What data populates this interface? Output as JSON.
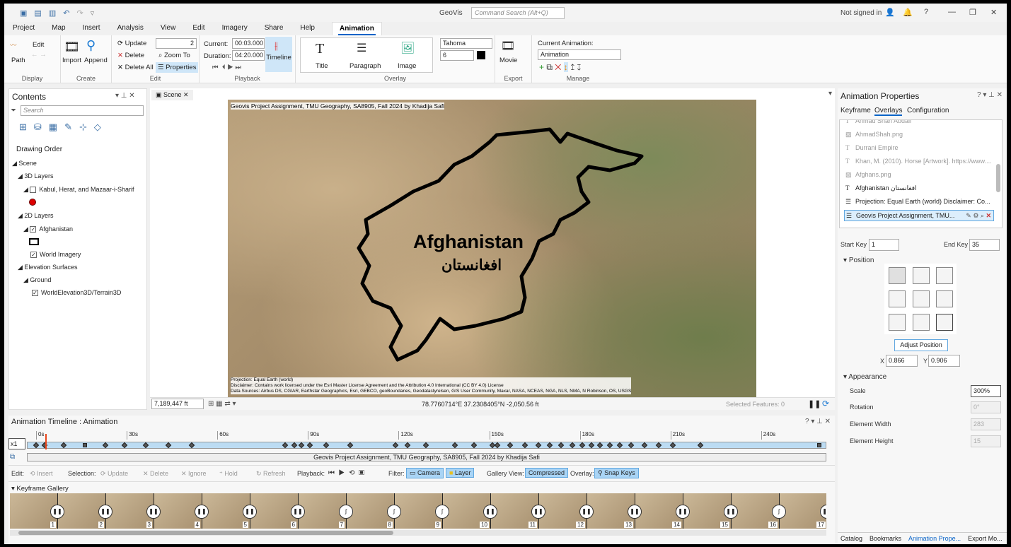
{
  "app": {
    "title": "GeoVis",
    "search_placeholder": "Command Search (Alt+Q)",
    "signin": "Not signed in",
    "help": "?"
  },
  "menu_tabs": [
    "Project",
    "Map",
    "Insert",
    "Analysis",
    "View",
    "Edit",
    "Imagery",
    "Share",
    "Help",
    "Animation"
  ],
  "ribbon": {
    "display": {
      "label": "Display",
      "path": "Path",
      "edit": "Edit"
    },
    "create": {
      "label": "Create",
      "import": "Import",
      "append": "Append"
    },
    "edit": {
      "label": "Edit",
      "update": "Update",
      "delete": "Delete",
      "delete_all": "Delete All",
      "zoom_to": "Zoom To",
      "properties": "Properties",
      "key_value": "2"
    },
    "playback": {
      "label": "Playback",
      "current_label": "Current:",
      "current": "00:03.000",
      "duration_label": "Duration:",
      "duration": "04:20.000",
      "timeline": "Timeline"
    },
    "overlay": {
      "label": "Overlay",
      "title": "Title",
      "paragraph": "Paragraph",
      "image": "Image",
      "font": "Tahoma",
      "size": "6",
      "color": "#000000"
    },
    "export": {
      "label": "Export",
      "movie": "Movie"
    },
    "manage": {
      "label": "Manage",
      "current_animation_label": "Current Animation:",
      "current_animation": "Animation"
    }
  },
  "contents": {
    "title": "Contents",
    "search_placeholder": "Search",
    "drawing_order": "Drawing Order",
    "tree": [
      {
        "label": "Scene",
        "level": 0
      },
      {
        "label": "3D Layers",
        "level": 1
      },
      {
        "label": "Kabul, Herat, and Mazaar-i-Sharif",
        "level": 2,
        "checked": false
      },
      {
        "label": "2D Layers",
        "level": 1
      },
      {
        "label": "Afghanistan",
        "level": 2,
        "checked": true
      },
      {
        "label": "World Imagery",
        "level": 2,
        "checked": true
      },
      {
        "label": "Elevation Surfaces",
        "level": 1
      },
      {
        "label": "Ground",
        "level": 2
      },
      {
        "label": "WorldElevation3D/Terrain3D",
        "level": 3,
        "checked": true
      }
    ]
  },
  "scene": {
    "tab": "Scene",
    "title_overlay": "Geovis Project Assignment, TMU Geography, SA8905, Fall 2024 by Khadija Safi",
    "label_en": "Afghanistan",
    "label_fa": "افغانستان",
    "footer": [
      "Projection: Equal Earth (world)",
      "Disclaimer: Contains work licensed under the Esri Master License Agreement and the Attribution 4.0 International (CC BY 4.0) License",
      "Data Sources: Airbus DS, CGIAR, Earthstar Geographics, Esri, GEBCO, geoBoundaries, Geodatastyrelsen, GIS User Community, Maxar, NASA, NCEAS, NGA, NLS, NMA, N Robinson, OS, USGS"
    ],
    "scale": "7,189,447 ft",
    "coords": "78.7760714°E 37.2308405°N",
    "elevation": "-2,050.56 ft",
    "selected": "Selected Features: 0"
  },
  "timeline": {
    "title": "Animation Timeline : Animation",
    "speed": "x1",
    "ticks": [
      "0s",
      "30s",
      "60s",
      "90s",
      "120s",
      "150s",
      "180s",
      "210s",
      "240s"
    ],
    "current_time": 3,
    "keyframes": [
      0,
      2.8,
      9.1,
      16.2,
      23,
      29.3,
      36.3,
      43.8,
      51.5,
      82.4,
      85.5,
      87.8,
      90.6,
      96,
      104,
      119,
      123,
      129,
      138.7,
      145,
      151,
      152.8,
      157,
      161.8,
      166.2,
      170,
      173.7,
      177.5,
      180.7,
      183.8,
      186.6,
      189.9,
      193.2,
      196.9,
      201.4,
      206,
      210.8,
      219.9,
      259.3
    ],
    "overlay_track": "Geovis Project Assignment, TMU Geography, SA8905, Fall 2024 by Khadija Safi",
    "toolbar": {
      "edit": "Edit:",
      "insert": "Insert",
      "selection": "Selection:",
      "update": "Update",
      "delete": "Delete",
      "ignore": "Ignore",
      "hold": "Hold",
      "refresh": "Refresh",
      "playback": "Playback:",
      "filter": "Filter:",
      "camera": "Camera",
      "layer": "Layer",
      "gallery_view": "Gallery View:",
      "compressed": "Compressed",
      "overlay": "Overlay:",
      "snap_keys": "Snap Keys"
    },
    "gallery_title": "Keyframe Gallery",
    "gallery": [
      "1",
      "2",
      "3",
      "4",
      "5",
      "6",
      "7",
      "8",
      "9",
      "10",
      "11",
      "12",
      "13",
      "14",
      "15",
      "16",
      "17"
    ]
  },
  "properties": {
    "title": "Animation Properties",
    "tabs": [
      "Keyframe",
      "Overlays",
      "Configuration"
    ],
    "overlays": [
      {
        "label": "Ahmad Shah Abdali",
        "type": "text",
        "dim": true
      },
      {
        "label": "AhmadShah.png",
        "type": "image",
        "dim": true
      },
      {
        "label": "Durrani Empire",
        "type": "text",
        "dim": true
      },
      {
        "label": "Khan, M. (2010). Horse [Artwork]. https://www....",
        "type": "text",
        "dim": true
      },
      {
        "label": "Afghans.png",
        "type": "image",
        "dim": true
      },
      {
        "label": "Afghanistan افغانستان",
        "type": "text",
        "dim": false
      },
      {
        "label": "Projection: Equal Earth (world) Disclaimer: Co...",
        "type": "paragraph",
        "dim": false
      },
      {
        "label": "Geovis Project Assignment, TMU...",
        "type": "paragraph",
        "dim": false,
        "selected": true
      }
    ],
    "start_key_label": "Start Key",
    "start_key": "1",
    "end_key_label": "End Key",
    "end_key": "35",
    "position": "Position",
    "adjust": "Adjust Position",
    "x_label": "X",
    "x": "0.866",
    "y_label": "Y",
    "y": "0.906",
    "appearance": "Appearance",
    "scale_label": "Scale",
    "scale": "300%",
    "rotation_label": "Rotation",
    "rotation": "0°",
    "width_label": "Element Width",
    "width": "283",
    "height_label": "Element Height",
    "height": "15"
  },
  "bottom_tabs": [
    "Catalog",
    "Bookmarks",
    "Animation Prope...",
    "Export Mo..."
  ]
}
